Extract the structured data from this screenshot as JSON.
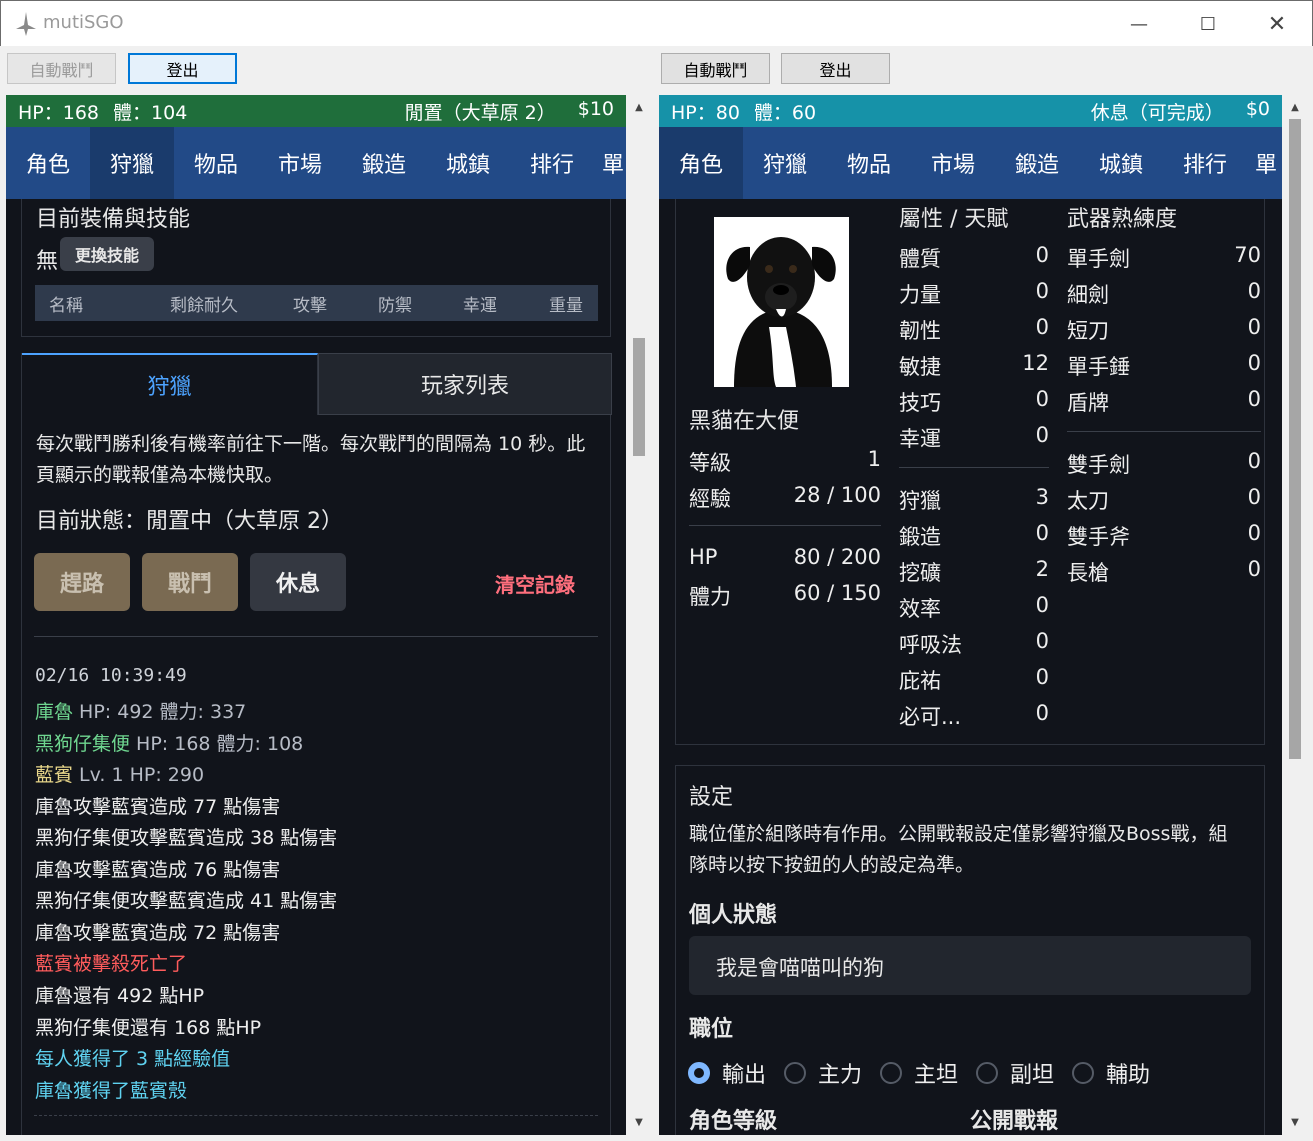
{
  "window": {
    "title": "mutiSGO"
  },
  "left": {
    "toolbar": {
      "auto_battle": "自動戰鬥",
      "logout": "登出"
    },
    "status": {
      "hp": "HP：168",
      "stamina": "體：104",
      "state": "閒置（大草原 2）",
      "money": "$10"
    },
    "nav": [
      "角色",
      "狩獵",
      "物品",
      "市場",
      "鍛造",
      "城鎮",
      "排行",
      "單"
    ],
    "equip": {
      "title": "目前裝備與技能",
      "none": "無",
      "change_skill": "更換技能",
      "columns": [
        "名稱",
        "剩餘耐久",
        "攻擊",
        "防禦",
        "幸運",
        "重量"
      ]
    },
    "tabs": [
      "狩獵",
      "玩家列表"
    ],
    "hunt": {
      "description": "每次戰鬥勝利後有機率前往下一階。每次戰鬥的間隔為 10 秒。此頁顯示的戰報僅為本機快取。",
      "current_state": "目前狀態：閒置中（大草原 2）",
      "buttons": [
        "趕路",
        "戰鬥",
        "休息"
      ],
      "clear_log": "清空記錄"
    },
    "log": {
      "timestamp": "02/16 10:39:49",
      "lines": [
        {
          "name": "庫魯",
          "rest": " HP: 492 體力: 337"
        },
        {
          "name": "黑狗仔集便",
          "rest": " HP: 168 體力: 108"
        },
        {
          "name": "藍賓",
          "rest": " Lv. 1  HP: 290"
        },
        {
          "text": "庫魯攻擊藍賓造成 77 點傷害"
        },
        {
          "text": "黑狗仔集便攻擊藍賓造成 38 點傷害"
        },
        {
          "text": "庫魯攻擊藍賓造成 76 點傷害"
        },
        {
          "text": "黑狗仔集便攻擊藍賓造成 41 點傷害"
        },
        {
          "text": "庫魯攻擊藍賓造成 72 點傷害"
        },
        {
          "text": "藍賓被擊殺死亡了"
        },
        {
          "text": "庫魯還有 492 點HP"
        },
        {
          "text": "黑狗仔集便還有 168 點HP"
        },
        {
          "text": "每人獲得了 3 點經驗值"
        },
        {
          "text": "庫魯獲得了藍賓殼"
        }
      ]
    }
  },
  "right": {
    "toolbar": {
      "auto_battle": "自動戰鬥",
      "logout": "登出"
    },
    "status": {
      "hp": "HP：80",
      "stamina": "體：60",
      "state": "休息（可完成）",
      "money": "$0"
    },
    "nav": [
      "角色",
      "狩獵",
      "物品",
      "市場",
      "鍛造",
      "城鎮",
      "排行",
      "單"
    ],
    "character": {
      "name": "黑貓在大便",
      "level_label": "等級",
      "level": "1",
      "exp_label": "經驗",
      "exp": "28 / 100",
      "hp_label": "HP",
      "hp": "80 / 200",
      "stamina_label": "體力",
      "stamina": "60 / 150"
    },
    "attributes": {
      "title": "屬性 / 天賦",
      "items": [
        {
          "label": "體質",
          "value": "0"
        },
        {
          "label": "力量",
          "value": "0"
        },
        {
          "label": "韌性",
          "value": "0"
        },
        {
          "label": "敏捷",
          "value": "12"
        },
        {
          "label": "技巧",
          "value": "0"
        },
        {
          "label": "幸運",
          "value": "0"
        }
      ],
      "talents": [
        {
          "label": "狩獵",
          "value": "3"
        },
        {
          "label": "鍛造",
          "value": "0"
        },
        {
          "label": "挖礦",
          "value": "2"
        },
        {
          "label": "效率",
          "value": "0"
        },
        {
          "label": "呼吸法",
          "value": "0"
        },
        {
          "label": "庇祐",
          "value": "0"
        },
        {
          "label": "必可...",
          "value": "0"
        }
      ]
    },
    "weapons": {
      "title": "武器熟練度",
      "one_hand": [
        {
          "label": "單手劍",
          "value": "70"
        },
        {
          "label": "細劍",
          "value": "0"
        },
        {
          "label": "短刀",
          "value": "0"
        },
        {
          "label": "單手錘",
          "value": "0"
        },
        {
          "label": "盾牌",
          "value": "0"
        }
      ],
      "two_hand": [
        {
          "label": "雙手劍",
          "value": "0"
        },
        {
          "label": "太刀",
          "value": "0"
        },
        {
          "label": "雙手斧",
          "value": "0"
        },
        {
          "label": "長槍",
          "value": "0"
        }
      ]
    },
    "settings": {
      "title": "設定",
      "description": "職位僅於組隊時有作用。公開戰報設定僅影響狩獵及Boss戰，組隊時以按下按鈕的人的設定為準。",
      "personal_status_label": "個人狀態",
      "personal_status_value": "我是會喵喵叫的狗",
      "role_label": "職位",
      "roles": [
        "輸出",
        "主力",
        "主坦",
        "副坦",
        "輔助"
      ],
      "selected_role": "輸出",
      "char_level_label": "角色等級",
      "public_report_label": "公開戰報"
    }
  },
  "colors": {
    "name_green": "#6fd690",
    "name_yellow": "#e8d68a",
    "kill_red": "#ff5c5c",
    "info_cyan": "#5fd2f0",
    "clear_pink": "#ff6f7d",
    "tab_active": "#4da3ff"
  }
}
